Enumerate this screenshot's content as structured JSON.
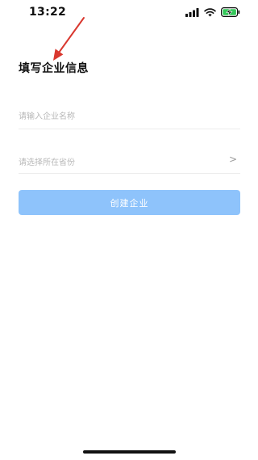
{
  "status_bar": {
    "time": "13:22"
  },
  "page": {
    "title": "填写企业信息"
  },
  "form": {
    "company_name": {
      "value": "",
      "placeholder": "请输入企业名称"
    },
    "province": {
      "placeholder": "请选择所在省份",
      "chevron": ">"
    },
    "create_button_label": "创建企业"
  },
  "colors": {
    "accent_disabled": "#8ec3fb",
    "annotation_arrow": "#d9382f",
    "divider": "#ececec",
    "placeholder_text": "#b8b8b8"
  },
  "icons": {
    "status": [
      "signal-icon",
      "wifi-icon",
      "battery-charging-icon"
    ],
    "annotation": "arrow-annotation-icon",
    "province": "chevron-right-icon"
  }
}
